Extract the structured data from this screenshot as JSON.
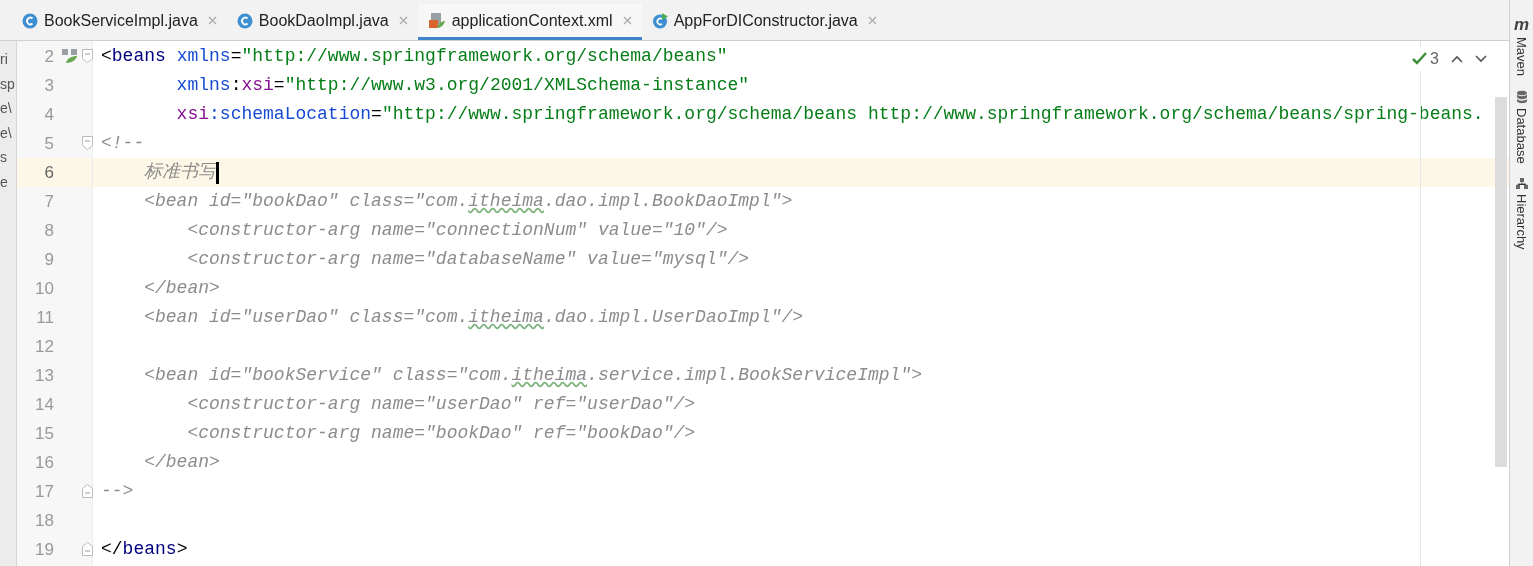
{
  "tabs": [
    {
      "label": "BookServiceImpl.java",
      "kind": "class",
      "selected": false
    },
    {
      "label": "BookDaoImpl.java",
      "kind": "class",
      "selected": false
    },
    {
      "label": "applicationContext.xml",
      "kind": "xml",
      "selected": true
    },
    {
      "label": "AppForDIConstructor.java",
      "kind": "runnable",
      "selected": false
    }
  ],
  "project_fragments": [
    "ri",
    "sp",
    "e\\",
    "e\\",
    "s",
    "e"
  ],
  "inspection": {
    "count": "3"
  },
  "lines": [
    {
      "number": "2",
      "kind": "fold_start",
      "current": false,
      "cursor": false,
      "tokens": [
        {
          "kind": "plain",
          "t": "<"
        },
        {
          "kind": "tag",
          "t": "beans "
        },
        {
          "kind": "attr",
          "t": "xmlns"
        },
        {
          "kind": "plain",
          "t": "="
        },
        {
          "kind": "val",
          "t": "\"http://www.springframework.org/schema/beans\""
        }
      ]
    },
    {
      "number": "3",
      "kind": "plain",
      "current": false,
      "cursor": false,
      "tokens": [
        {
          "kind": "attr",
          "t": "       xmlns"
        },
        {
          "kind": "plain",
          "t": ":"
        },
        {
          "kind": "ns",
          "t": "xsi"
        },
        {
          "kind": "plain",
          "t": "="
        },
        {
          "kind": "val",
          "t": "\"http://www.w3.org/2001/XMLSchema-instance\""
        }
      ]
    },
    {
      "number": "4",
      "kind": "plain",
      "current": false,
      "cursor": false,
      "tokens": [
        {
          "kind": "ns",
          "t": "       xsi"
        },
        {
          "kind": "attr",
          "t": ":schemaLocation"
        },
        {
          "kind": "plain",
          "t": "="
        },
        {
          "kind": "val",
          "t": "\"http://www.springframework.org/schema/beans http://www.springframework.org/schema/beans/spring-beans."
        }
      ]
    },
    {
      "number": "5",
      "kind": "fold_start",
      "current": false,
      "cursor": false,
      "tokens": [
        {
          "kind": "c",
          "t": "<!--"
        }
      ]
    },
    {
      "number": "6",
      "kind": "plain",
      "current": true,
      "cursor": true,
      "tokens": [
        {
          "kind": "c",
          "t": "    标准书写"
        }
      ]
    },
    {
      "number": "7",
      "kind": "plain",
      "current": false,
      "cursor": false,
      "tokens": [
        {
          "kind": "c",
          "t": "    <bean id=\"bookDao\" class=\"com."
        },
        {
          "kind": "ct",
          "t": "itheima"
        },
        {
          "kind": "c",
          "t": ".dao.impl.BookDaoImpl\">"
        }
      ]
    },
    {
      "number": "8",
      "kind": "plain",
      "current": false,
      "cursor": false,
      "tokens": [
        {
          "kind": "c",
          "t": "        <constructor-arg name=\"connectionNum\" value=\"10\"/>"
        }
      ]
    },
    {
      "number": "9",
      "kind": "plain",
      "current": false,
      "cursor": false,
      "tokens": [
        {
          "kind": "c",
          "t": "        <constructor-arg name=\"databaseName\" value=\"mysql\"/>"
        }
      ]
    },
    {
      "number": "10",
      "kind": "plain",
      "current": false,
      "cursor": false,
      "tokens": [
        {
          "kind": "c",
          "t": "    </bean>"
        }
      ]
    },
    {
      "number": "11",
      "kind": "plain",
      "current": false,
      "cursor": false,
      "tokens": [
        {
          "kind": "c",
          "t": "    <bean id=\"userDao\" class=\"com."
        },
        {
          "kind": "ct",
          "t": "itheima"
        },
        {
          "kind": "c",
          "t": ".dao.impl.UserDaoImpl\"/>"
        }
      ]
    },
    {
      "number": "12",
      "kind": "plain",
      "current": false,
      "cursor": false
    },
    {
      "number": "13",
      "kind": "plain",
      "current": false,
      "cursor": false,
      "tokens": [
        {
          "kind": "c",
          "t": "    <bean id=\"bookService\" class=\"com."
        },
        {
          "kind": "ct",
          "t": "itheima"
        },
        {
          "kind": "c",
          "t": ".service.impl.BookServiceImpl\">"
        }
      ]
    },
    {
      "number": "14",
      "kind": "plain",
      "current": false,
      "cursor": false,
      "tokens": [
        {
          "kind": "c",
          "t": "        <constructor-arg name=\"userDao\" ref=\"userDao\"/>"
        }
      ]
    },
    {
      "number": "15",
      "kind": "plain",
      "current": false,
      "cursor": false,
      "tokens": [
        {
          "kind": "c",
          "t": "        <constructor-arg name=\"bookDao\" ref=\"bookDao\"/>"
        }
      ]
    },
    {
      "number": "16",
      "kind": "plain",
      "current": false,
      "cursor": false,
      "tokens": [
        {
          "kind": "c",
          "t": "    </bean>"
        }
      ]
    },
    {
      "number": "17",
      "kind": "fold_end",
      "current": false,
      "cursor": false,
      "tokens": [
        {
          "kind": "c",
          "t": "-->"
        }
      ]
    },
    {
      "number": "18",
      "kind": "plain",
      "current": false,
      "cursor": false
    },
    {
      "number": "19",
      "kind": "fold_end",
      "current": false,
      "cursor": false,
      "tokens": [
        {
          "kind": "plain",
          "t": "</"
        },
        {
          "kind": "tag",
          "t": "beans"
        },
        {
          "kind": "plain",
          "t": ">"
        }
      ]
    }
  ],
  "tool_windows": [
    {
      "label": "Maven",
      "kind": "maven",
      "glyph": "m"
    },
    {
      "label": "Database",
      "kind": "database"
    },
    {
      "label": "Hierarchy",
      "kind": "hierarchy"
    }
  ]
}
